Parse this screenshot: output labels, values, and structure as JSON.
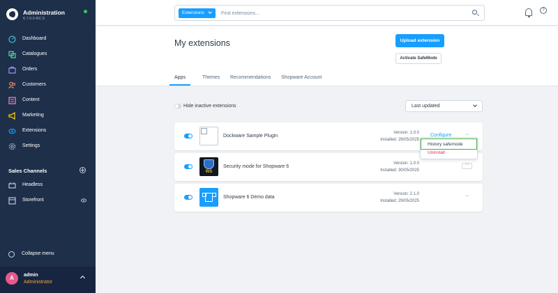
{
  "app": {
    "title": "Administration",
    "version": "6.7.0.0-RC.5"
  },
  "sidebar": {
    "items": [
      {
        "label": "Dashboard",
        "icon": "dashboard-icon",
        "color": "#3ec1d3"
      },
      {
        "label": "Catalogues",
        "icon": "catalogues-icon",
        "color": "#57d9a3"
      },
      {
        "label": "Orders",
        "icon": "orders-icon",
        "color": "#a092f0"
      },
      {
        "label": "Customers",
        "icon": "customers-icon",
        "color": "#f88962"
      },
      {
        "label": "Content",
        "icon": "content-icon",
        "color": "#ff85c2"
      },
      {
        "label": "Marketing",
        "icon": "marketing-icon",
        "color": "#ffd700"
      },
      {
        "label": "Extensions",
        "icon": "extensions-icon",
        "color": "#189eff"
      },
      {
        "label": "Settings",
        "icon": "settings-icon",
        "color": "#a9b4c4"
      }
    ],
    "sales_channels_title": "Sales Channels",
    "sales_channels": [
      {
        "label": "Headless",
        "icon": "headless-icon"
      },
      {
        "label": "Storefront",
        "icon": "storefront-icon"
      }
    ],
    "collapse_label": "Collapse menu",
    "user": {
      "initial": "A",
      "name": "admin",
      "role": "Administrator"
    }
  },
  "topbar": {
    "search_type": "Extensions",
    "search_placeholder": "Find extensions..."
  },
  "page": {
    "title": "My extensions",
    "upload_button": "Upload extension",
    "safemode_button": "Activate SafeMode",
    "tabs": [
      "Apps",
      "Themes",
      "Recommendations",
      "Shopware Account"
    ],
    "active_tab": "Apps"
  },
  "filters": {
    "hide_inactive_label": "Hide inactive extensions",
    "sort_value": "Last updated"
  },
  "extensions": [
    {
      "name": "Dockware Sample Plugin",
      "version": "Version: 1.0.0",
      "installed": "Installed: 29/05/2025",
      "active": true
    },
    {
      "name": "Security mode for Shopware 6",
      "version": "Version: 1.0.0",
      "installed": "Installed: 30/05/2025",
      "active": true,
      "logo_text": "WS"
    },
    {
      "name": "Shopware 6 Demo data",
      "version": "Version: 2.1.0",
      "installed": "Installed: 29/05/2025",
      "active": true
    }
  ],
  "context_menu": {
    "configure": "Configure",
    "history": "History safemode",
    "uninstall": "Uninstall"
  },
  "colors": {
    "accent": "#189eff",
    "sidebar_bg": "#1e2f4a",
    "danger": "#de294c",
    "highlight": "#3cb043"
  }
}
